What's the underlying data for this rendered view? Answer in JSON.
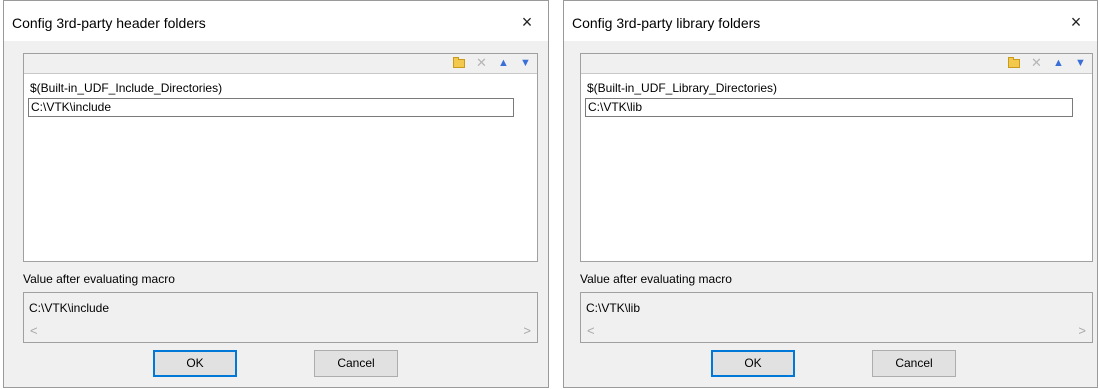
{
  "dialogs": [
    {
      "title": "Config 3rd-party header folders",
      "close_glyph": "×",
      "toolbar": {
        "icons": [
          "folder-icon",
          "delete-icon",
          "up-arrow-icon",
          "down-arrow-icon"
        ]
      },
      "list_items": [
        "$(Built-in_UDF_Include_Directories)",
        "C:\\VTK\\include"
      ],
      "value_label": "Value after evaluating macro",
      "value_text": "C:\\VTK\\include",
      "buttons": {
        "ok": "OK",
        "cancel": "Cancel"
      }
    },
    {
      "title": "Config 3rd-party library folders",
      "close_glyph": "×",
      "toolbar": {
        "icons": [
          "folder-icon",
          "delete-icon",
          "up-arrow-icon",
          "down-arrow-icon"
        ]
      },
      "list_items": [
        "$(Built-in_UDF_Library_Directories)",
        "C:\\VTK\\lib"
      ],
      "value_label": "Value after evaluating macro",
      "value_text": "C:\\VTK\\lib",
      "buttons": {
        "ok": "OK",
        "cancel": "Cancel"
      }
    }
  ],
  "colors": {
    "accent": "#0078d7",
    "dialog_bg": "#f0f0f0",
    "arrow_blue": "#3a6fd8"
  }
}
